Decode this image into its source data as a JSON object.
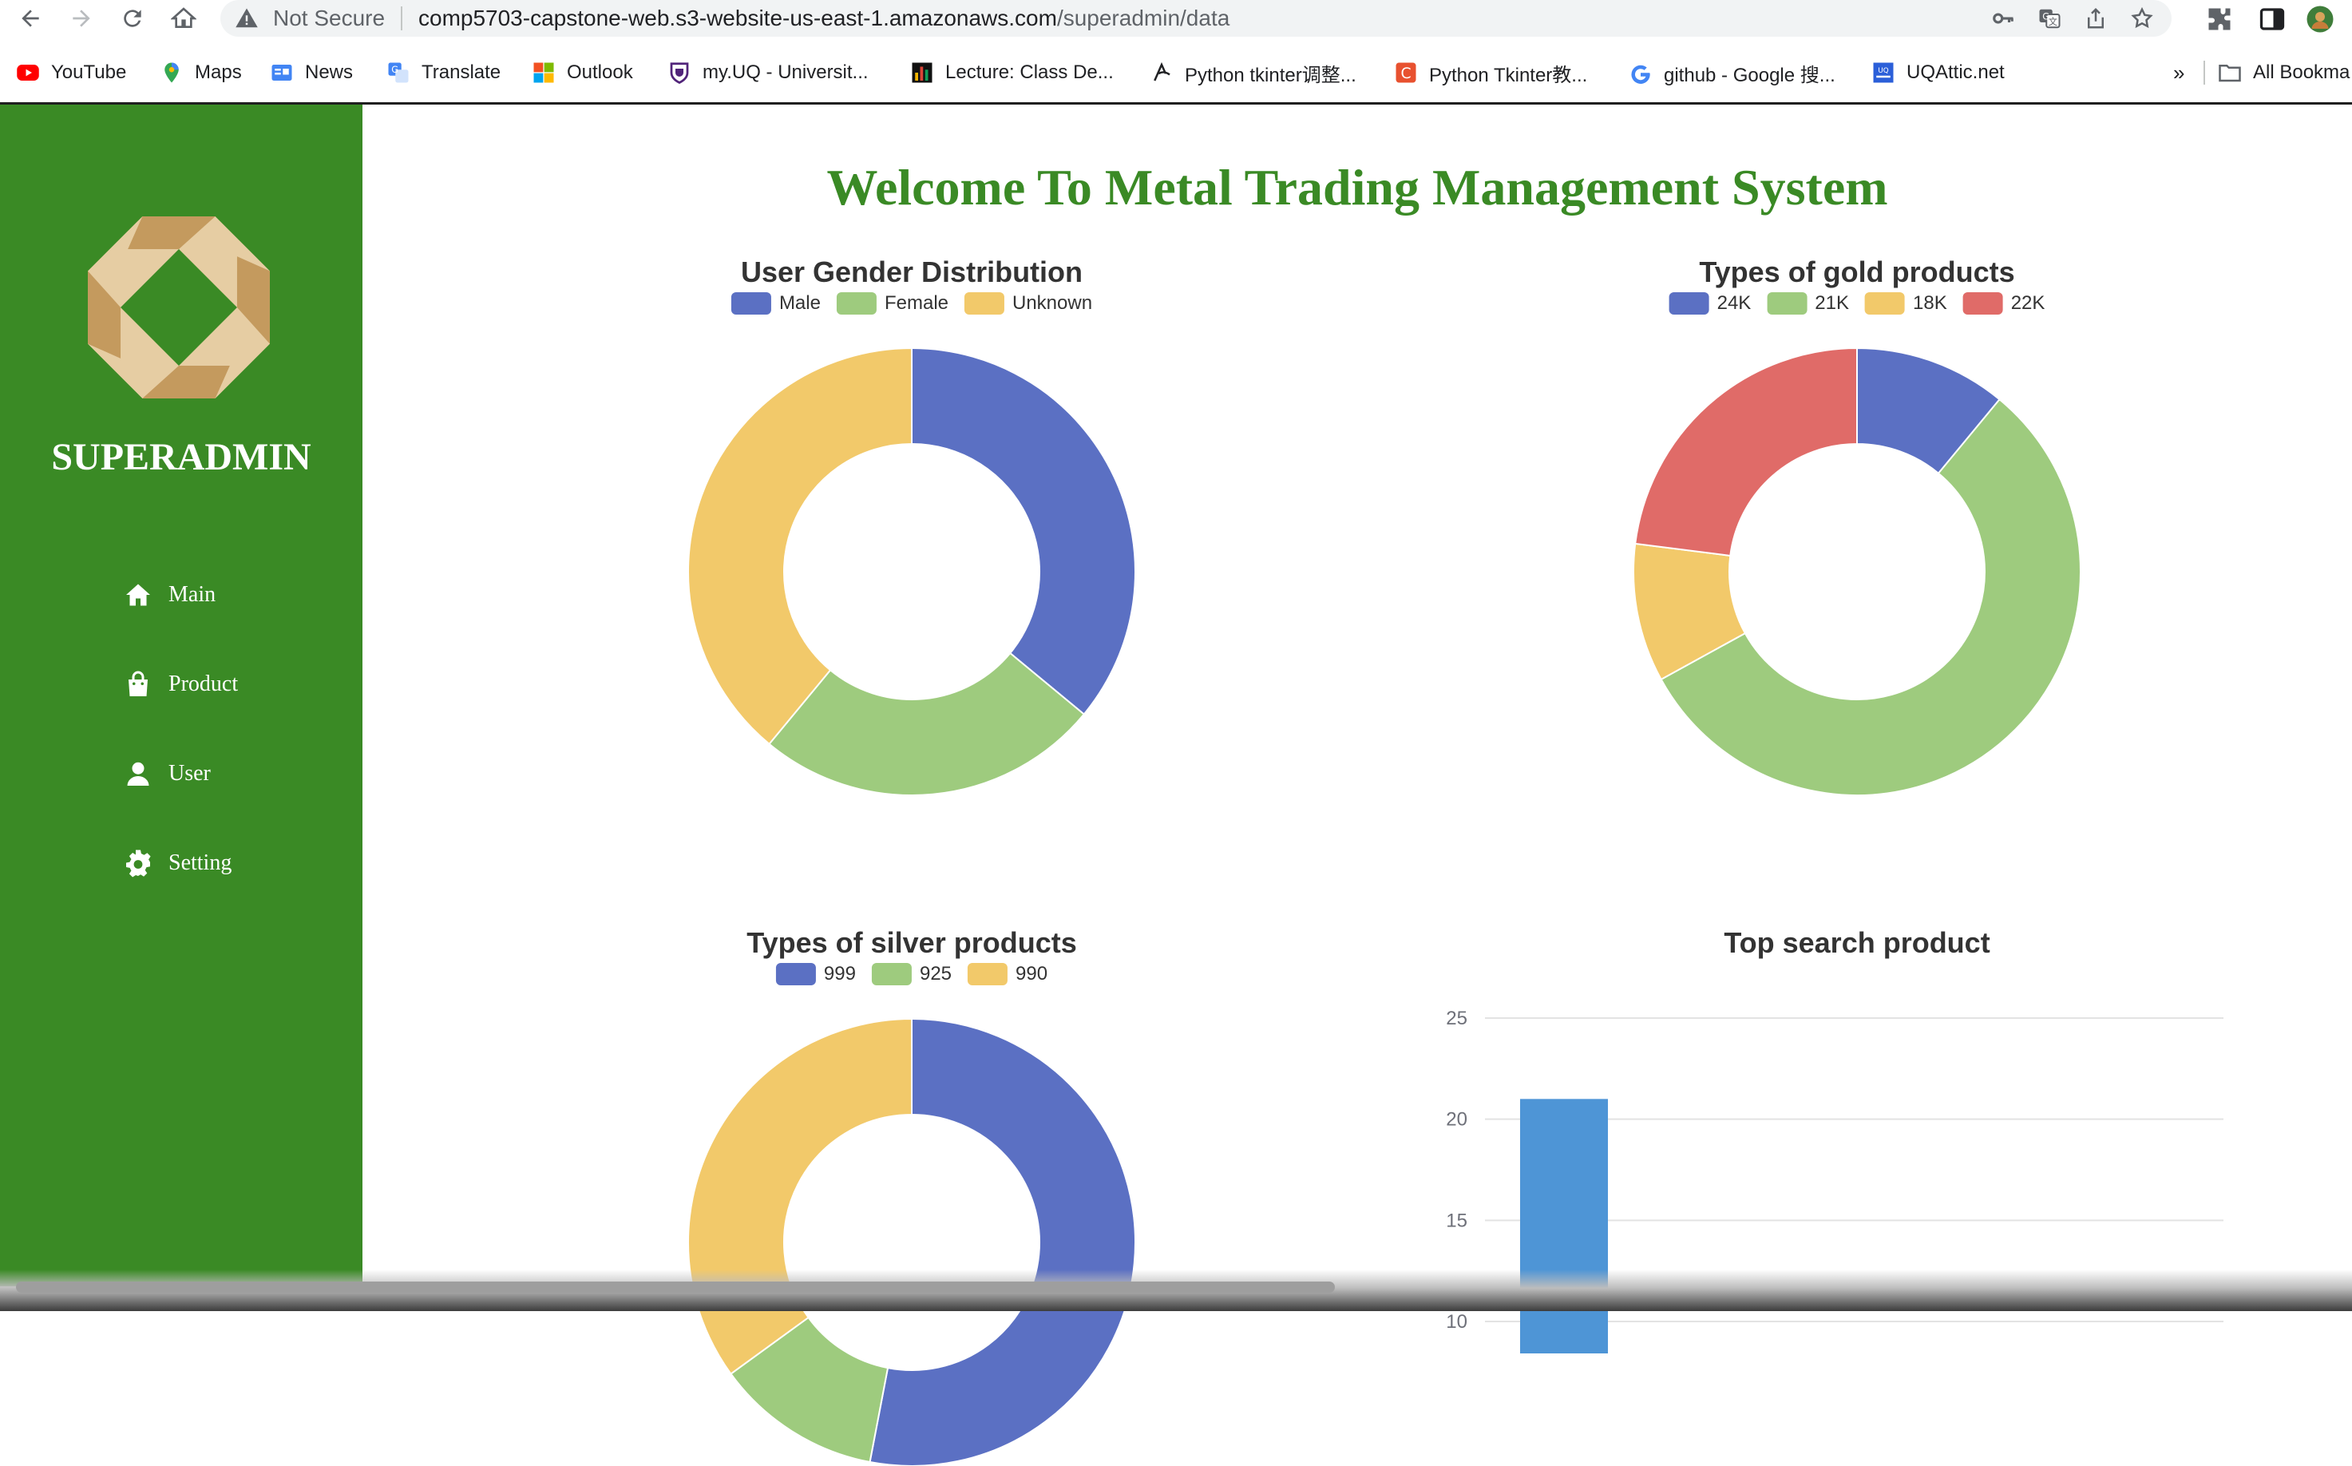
{
  "browser": {
    "security_label": "Not Secure",
    "url_host": "comp5703-capstone-web.s3-website-us-east-1.amazonaws.com",
    "url_path": "/superadmin/data",
    "bookmarks": [
      {
        "label": "YouTube",
        "icon": "youtube-icon"
      },
      {
        "label": "Maps",
        "icon": "maps-icon"
      },
      {
        "label": "News",
        "icon": "news-icon"
      },
      {
        "label": "Translate",
        "icon": "translate-icon"
      },
      {
        "label": "Outlook",
        "icon": "outlook-icon"
      },
      {
        "label": "my.UQ - Universit...",
        "icon": "uq-crest-icon"
      },
      {
        "label": "Lecture: Class De...",
        "icon": "lecture-icon"
      },
      {
        "label": "Python tkinter调整...",
        "icon": "python-icon"
      },
      {
        "label": "Python Tkinter教...",
        "icon": "c-site-icon"
      },
      {
        "label": "github - Google 搜...",
        "icon": "google-icon"
      },
      {
        "label": "UQAttic.net",
        "icon": "uqattic-icon"
      }
    ],
    "overflow_label": "»",
    "all_bookmarks_label": "All Bookma"
  },
  "sidebar": {
    "title": "SUPERADMIN",
    "items": [
      {
        "label": "Main",
        "icon": "home-icon"
      },
      {
        "label": "Product",
        "icon": "shopping-bag-icon"
      },
      {
        "label": "User",
        "icon": "user-icon"
      },
      {
        "label": "Setting",
        "icon": "gear-icon"
      }
    ]
  },
  "main": {
    "title": "Welcome To Metal Trading Management System"
  },
  "colors": {
    "brand_green": "#3a8a25",
    "blue": "#5b70c3",
    "green": "#9ecb7e",
    "yellow": "#f2c96a",
    "red": "#e06b68",
    "bar_blue": "#4e95d6"
  },
  "chart_data": [
    {
      "type": "pie",
      "variant": "doughnut",
      "title": "User Gender Distribution",
      "labels": [
        "Male",
        "Female",
        "Unknown"
      ],
      "values": [
        36,
        25,
        39
      ],
      "colors": [
        "#5b70c3",
        "#9ecb7e",
        "#f2c96a"
      ]
    },
    {
      "type": "pie",
      "variant": "doughnut",
      "title": "Types of gold products",
      "labels": [
        "24K",
        "21K",
        "18K",
        "22K"
      ],
      "values": [
        11,
        56,
        10,
        23
      ],
      "colors": [
        "#5b70c3",
        "#9ecb7e",
        "#f2c96a",
        "#e06b68"
      ]
    },
    {
      "type": "pie",
      "variant": "doughnut",
      "title": "Types of silver products",
      "labels": [
        "999",
        "925",
        "990"
      ],
      "values": [
        53,
        12,
        35
      ],
      "colors": [
        "#5b70c3",
        "#9ecb7e",
        "#f2c96a"
      ]
    },
    {
      "type": "bar",
      "title": "Top search product",
      "categories": [
        ""
      ],
      "values": [
        21
      ],
      "ylim": [
        10,
        25
      ],
      "yticks": [
        10,
        15,
        20,
        25
      ],
      "grid": true,
      "colors": [
        "#4e95d6"
      ]
    }
  ]
}
